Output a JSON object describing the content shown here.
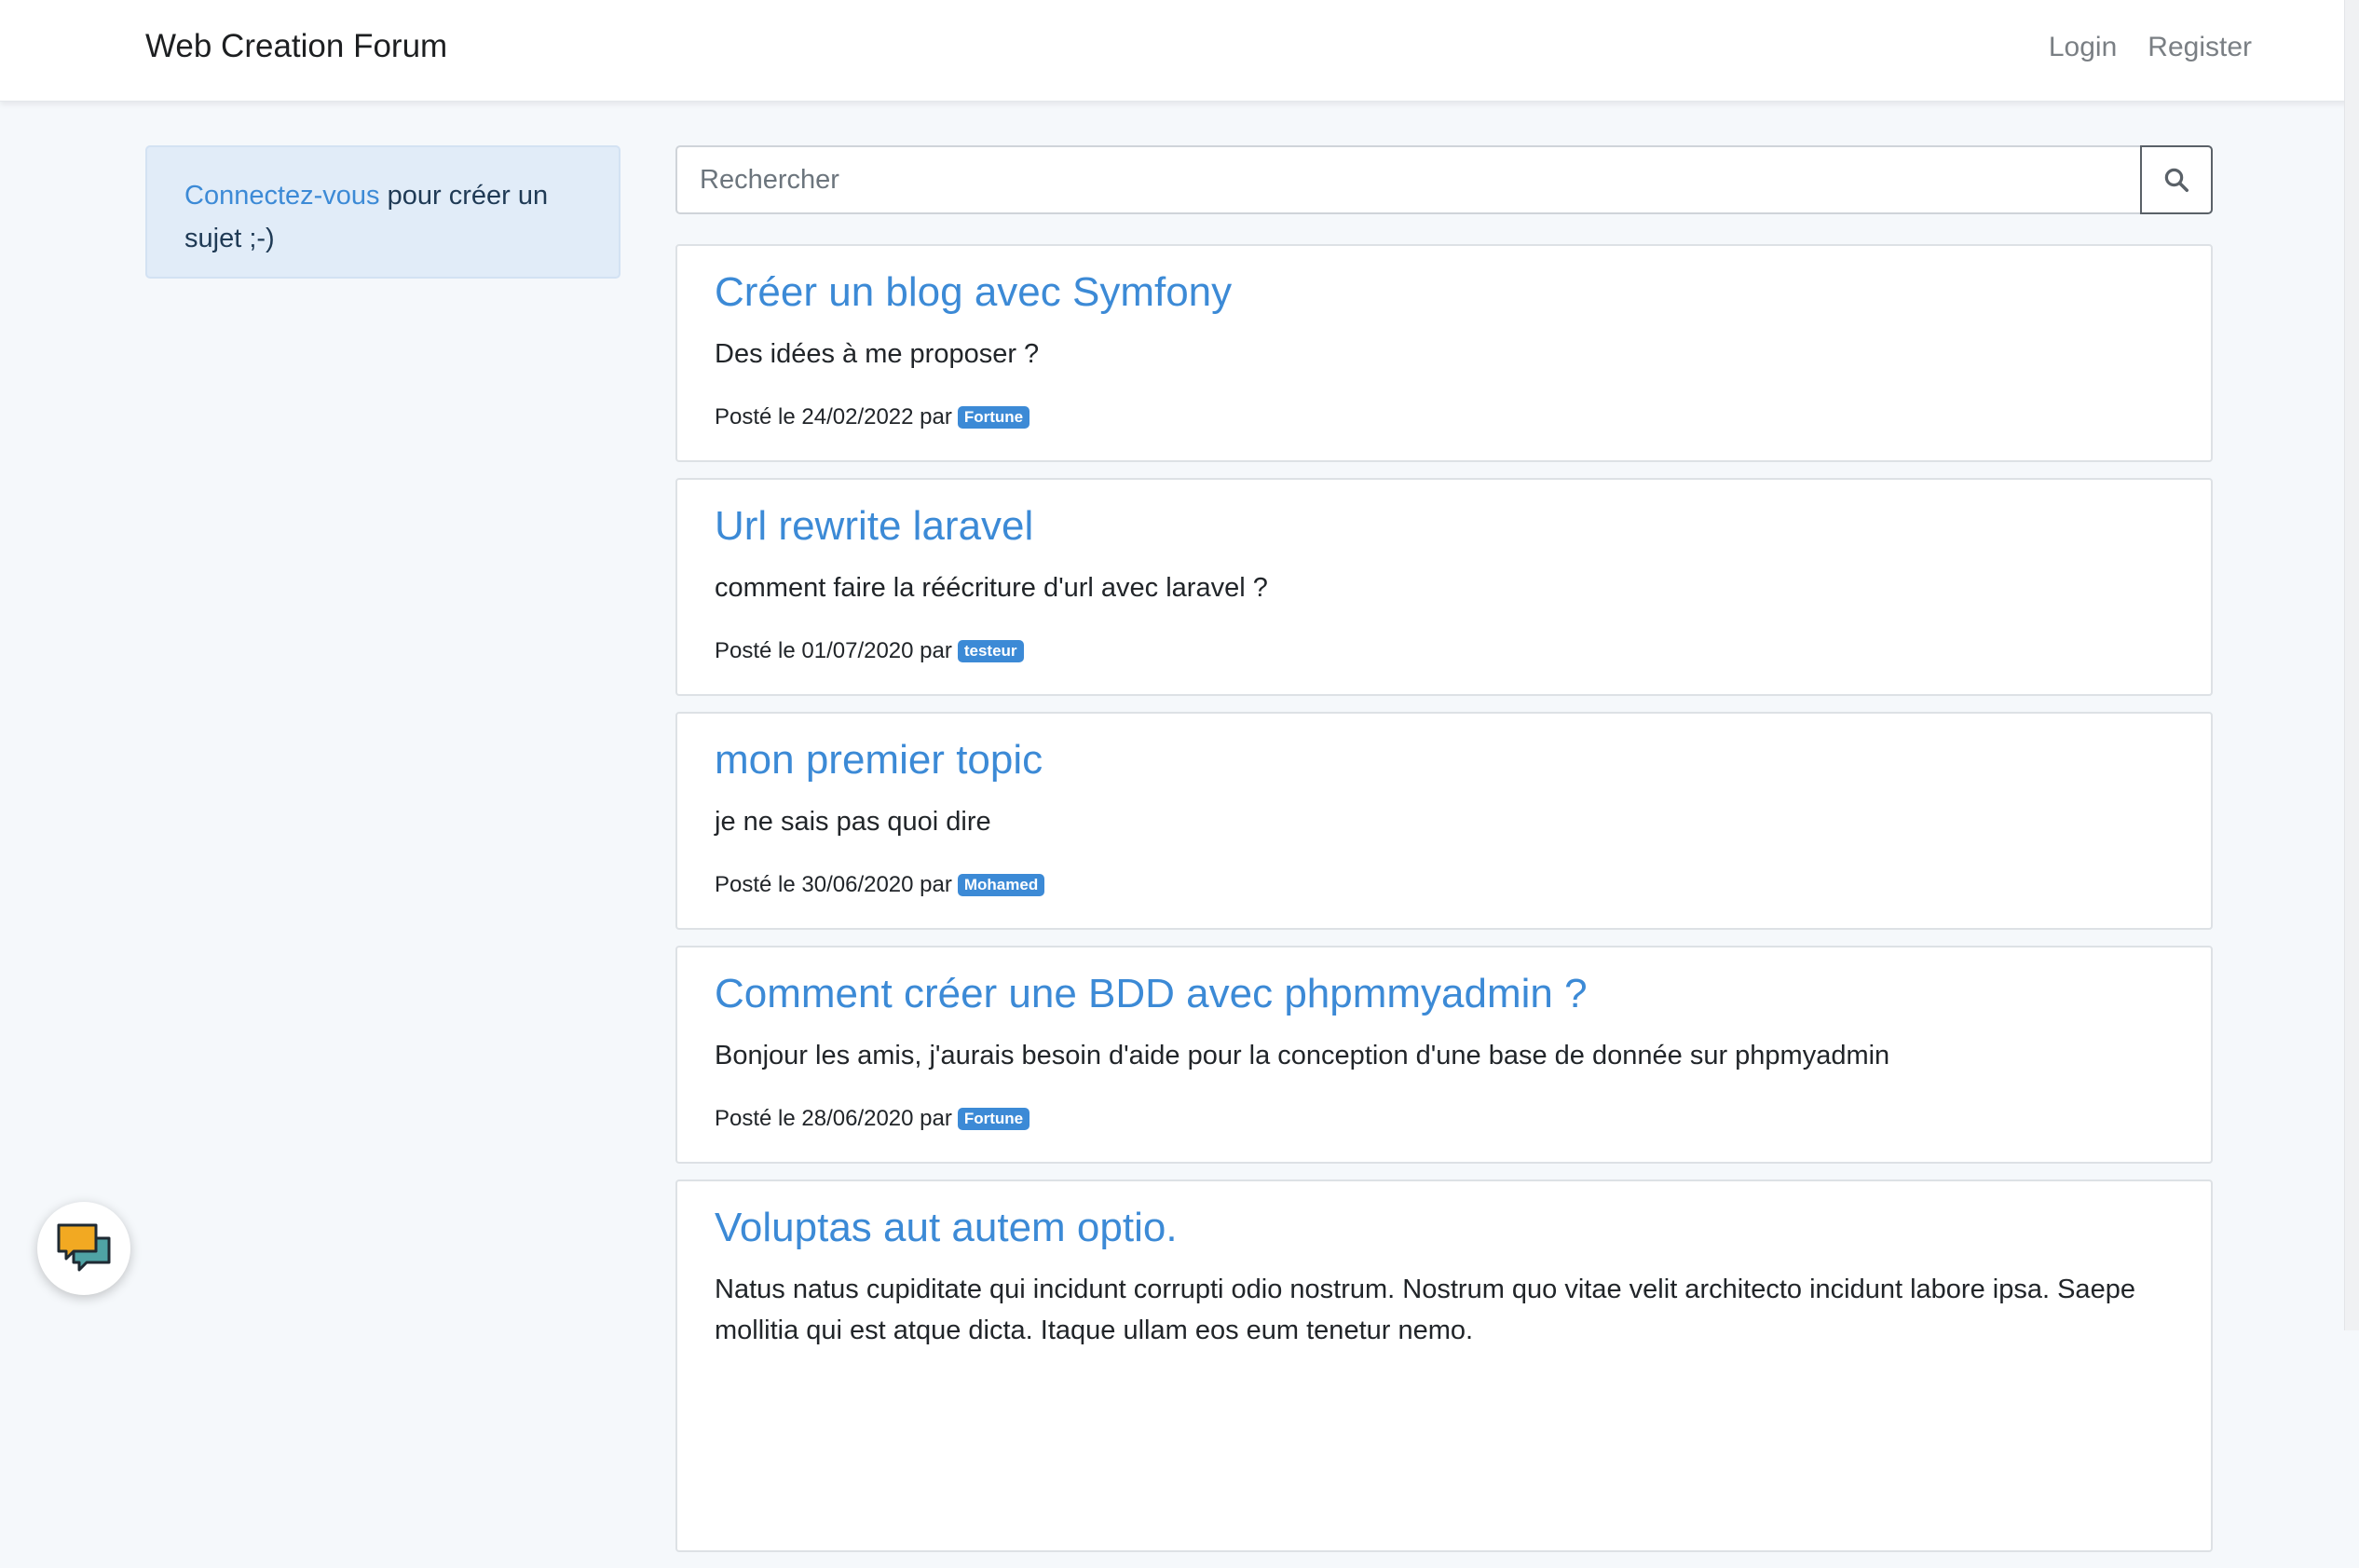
{
  "navbar": {
    "brand": "Web Creation Forum",
    "links": [
      "Login",
      "Register"
    ]
  },
  "sidebar": {
    "alert_link": "Connectez-vous",
    "alert_text": " pour créer un sujet ;-)"
  },
  "search": {
    "placeholder": "Rechercher",
    "icon": "search-icon"
  },
  "topics": [
    {
      "title": "Créer un blog avec Symfony",
      "body": "Des idées à me proposer ?",
      "posted_label": "Posté le 24/02/2022 par",
      "author": "Fortune"
    },
    {
      "title": "Url rewrite laravel",
      "body": "comment faire la réécriture d'url avec laravel ?",
      "posted_label": "Posté le 01/07/2020 par",
      "author": "testeur"
    },
    {
      "title": "mon premier topic",
      "body": "je ne sais pas quoi dire",
      "posted_label": "Posté le 30/06/2020 par",
      "author": "Mohamed"
    },
    {
      "title": "Comment créer une BDD avec phpmmyadmin ?",
      "body": "Bonjour les amis, j'aurais besoin d'aide pour la conception d'une base de donnée sur phpmyadmin",
      "posted_label": "Posté le 28/06/2020 par",
      "author": "Fortune"
    },
    {
      "title": "Voluptas aut autem optio.",
      "body": "Natus natus cupiditate qui incidunt corrupti odio nostrum. Nostrum quo vitae velit architecto incidunt labore ipsa. Saepe mollitia qui est atque dicta. Itaque ullam eos eum tenetur nemo."
    }
  ],
  "chat_widget": {
    "icon": "chat-bubbles-icon"
  },
  "colors": {
    "accent": "#3c8ad6",
    "alert_bg": "#e1ecf8",
    "page_bg": "#f5f8fb"
  }
}
